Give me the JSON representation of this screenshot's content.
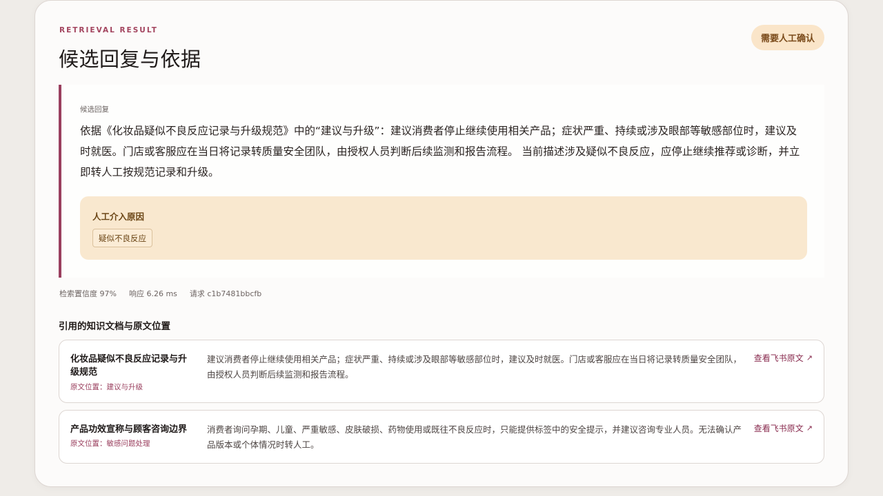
{
  "header": {
    "eyebrow": "RETRIEVAL RESULT",
    "title": "候选回复与依据",
    "badge": "需要人工确认"
  },
  "answer": {
    "label": "候选回复",
    "text": "依据《化妆品疑似不良反应记录与升级规范》中的“建议与升级”：建议消费者停止继续使用相关产品；症状严重、持续或涉及眼部等敏感部位时，建议及时就医。门店或客服应在当日将记录转质量安全团队，由授权人员判断后续监测和报告流程。 当前描述涉及疑似不良反应，应停止继续推荐或诊断，并立即转人工按规范记录和升级。",
    "reason_title": "人工介入原因",
    "reason_tag": "疑似不良反应"
  },
  "meta": {
    "confidence": "检索置信度 97%",
    "latency": "响应 6.26 ms",
    "request": "请求 c1b7481bbcfb"
  },
  "citations": {
    "section_title": "引用的知识文档与原文位置",
    "items": [
      {
        "name": "化妆品疑似不良反应记录与升级规范",
        "location": "原文位置：建议与升级",
        "excerpt": "建议消费者停止继续使用相关产品；症状严重、持续或涉及眼部等敏感部位时，建议及时就医。门店或客服应在当日将记录转质量安全团队，由授权人员判断后续监测和报告流程。",
        "link": "查看飞书原文"
      },
      {
        "name": "产品功效宣称与顾客咨询边界",
        "location": "原文位置：敏感问题处理",
        "excerpt": "消费者询问孕期、儿童、严重敏感、皮肤破损、药物使用或既往不良反应时，只能提供标签中的安全提示，并建议咨询专业人员。无法确认产品版本或个体情况时转人工。",
        "link": "查看飞书原文"
      }
    ]
  },
  "colors": {
    "accent": "#9a3f5e",
    "badge_bg": "#fae5c9",
    "reason_bg": "#f9e8cf"
  },
  "icons": {
    "external_link": "arrow-up-right-icon"
  }
}
